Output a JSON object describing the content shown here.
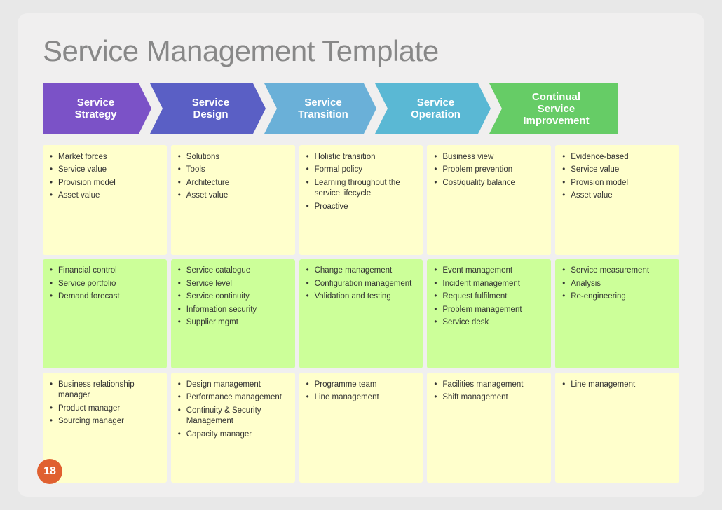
{
  "title": "Service Management Template",
  "page_number": "18",
  "arrows": [
    {
      "id": "ss",
      "label": "Service\nStrategy",
      "color": "#7b52c7",
      "type": "first"
    },
    {
      "id": "sd",
      "label": "Service\nDesign",
      "color": "#5a5fc5",
      "type": "middle"
    },
    {
      "id": "st",
      "label": "Service\nTransition",
      "color": "#6ab0d8",
      "type": "middle"
    },
    {
      "id": "so",
      "label": "Service\nOperation",
      "color": "#5ab8d4",
      "type": "middle"
    },
    {
      "id": "csi",
      "label": "Continual\nService\nImprovement",
      "color": "#66cc66",
      "type": "last"
    }
  ],
  "rows": [
    {
      "cells": [
        {
          "bg": "yellow",
          "items": [
            "Market forces",
            "Service value",
            "Provision model",
            "Asset value"
          ]
        },
        {
          "bg": "yellow",
          "items": [
            "Solutions",
            "Tools",
            "Architecture",
            "Asset value"
          ]
        },
        {
          "bg": "yellow",
          "items": [
            "Holistic transition",
            "Formal policy",
            "Learning throughout the service lifecycle",
            "Proactive"
          ]
        },
        {
          "bg": "yellow",
          "items": [
            "Business view",
            "Problem prevention",
            "Cost/quality balance"
          ]
        },
        {
          "bg": "yellow",
          "items": [
            "Evidence-based",
            "Service value",
            "Provision model",
            "Asset value"
          ]
        }
      ]
    },
    {
      "cells": [
        {
          "bg": "green",
          "items": [
            "Financial control",
            "Service portfolio",
            "Demand forecast"
          ]
        },
        {
          "bg": "green",
          "items": [
            "Service catalogue",
            "Service level",
            "Service continuity",
            "Information security",
            "Supplier mgmt"
          ]
        },
        {
          "bg": "green",
          "items": [
            "Change management",
            "Configuration management",
            "Validation and testing"
          ]
        },
        {
          "bg": "green",
          "items": [
            "Event management",
            "Incident management",
            "Request fulfilment",
            "Problem management",
            "Service desk"
          ]
        },
        {
          "bg": "green",
          "items": [
            "Service measurement",
            "Analysis",
            "Re-engineering"
          ]
        }
      ]
    },
    {
      "cells": [
        {
          "bg": "yellow",
          "items": [
            "Business relationship manager",
            "Product manager",
            "Sourcing manager"
          ]
        },
        {
          "bg": "yellow",
          "items": [
            "Design management",
            "Performance management",
            "Continuity & Security Management",
            "Capacity manager"
          ]
        },
        {
          "bg": "yellow",
          "items": [
            "Programme team",
            "Line management"
          ]
        },
        {
          "bg": "yellow",
          "items": [
            "Facilities management",
            "Shift management"
          ]
        },
        {
          "bg": "yellow",
          "items": [
            "Line management"
          ]
        }
      ]
    }
  ]
}
